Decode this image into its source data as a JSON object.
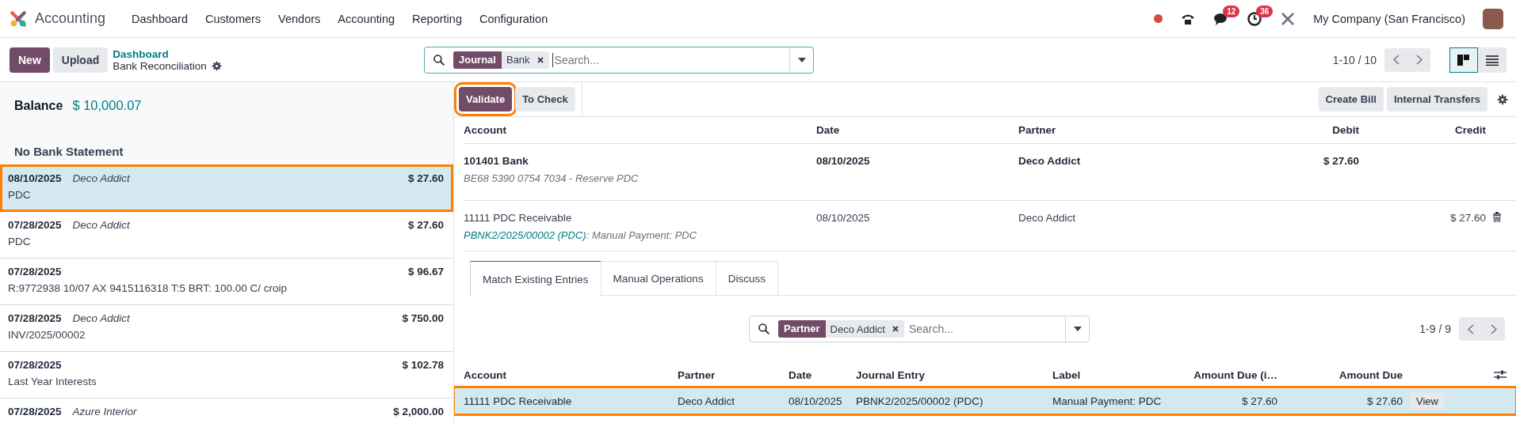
{
  "navbar": {
    "app": "Accounting",
    "menu": [
      "Dashboard",
      "Customers",
      "Vendors",
      "Accounting",
      "Reporting",
      "Configuration"
    ],
    "messages_count": "12",
    "activities_count": "36",
    "company": "My Company (San Francisco)"
  },
  "control_panel": {
    "buttons": [
      {
        "label": "New",
        "primary": true
      },
      {
        "label": "Upload",
        "primary": false
      }
    ],
    "breadcrumb": {
      "parent": "Dashboard",
      "current": "Bank Reconciliation"
    },
    "search": {
      "facets": [
        {
          "label": "Journal",
          "value": "Bank"
        }
      ],
      "placeholder": "Search..."
    },
    "pager": "1-10 / 10",
    "views": [
      {
        "kind": "kanban",
        "selected": true
      },
      {
        "kind": "list",
        "selected": false
      }
    ]
  },
  "statement_panel": {
    "balance_label": "Balance",
    "balance": "$ 10,000.07",
    "group": "No Bank Statement",
    "lines": [
      {
        "date": "08/10/2025",
        "partner": "Deco Addict",
        "amount": "$ 27.60",
        "label": "PDC",
        "selected": true,
        "highlighted": true
      },
      {
        "date": "07/28/2025",
        "partner": "Deco Addict",
        "amount": "$ 27.60",
        "label": "PDC",
        "selected": false,
        "highlighted": false
      },
      {
        "date": "07/28/2025",
        "amount": "$ 96.67",
        "label": "R:9772938 10/07 AX 9415116318 T:5 BRT: 100.00 C/ croip",
        "selected": false,
        "highlighted": false
      },
      {
        "date": "07/28/2025",
        "partner": "Deco Addict",
        "amount": "$ 750.00",
        "label": "INV/2025/00002",
        "selected": false,
        "highlighted": false
      },
      {
        "date": "07/28/2025",
        "amount": "$ 102.78",
        "label": "Last Year Interests",
        "selected": false,
        "highlighted": false
      },
      {
        "date": "07/28/2025",
        "partner": "Azure Interior",
        "amount": "$ 2,000.00",
        "selected": false,
        "highlighted": false
      }
    ]
  },
  "entry_panel": {
    "actions": [
      {
        "label": "Validate",
        "primary": true,
        "highlighted": true
      },
      {
        "label": "To Check",
        "primary": false,
        "highlighted": false
      }
    ],
    "extra_actions": [
      "Create Bill",
      "Internal Transfers"
    ],
    "columns": [
      "Account",
      "Date",
      "Partner",
      "Debit",
      "Credit"
    ],
    "lines": [
      {
        "kind": "bank",
        "account": "101401 Bank",
        "detail": "BE68 5390 0754 7034 - Reserve PDC",
        "date": "08/10/2025",
        "partner": "Deco Addict",
        "debit": "$ 27.60"
      },
      {
        "kind": "counterpart",
        "account": "11111 PDC Receivable",
        "link": "PBNK2/2025/00002 (PDC)",
        "detail": ": Manual Payment: PDC",
        "date": "08/10/2025",
        "partner": "Deco Addict",
        "credit": "$ 27.60"
      }
    ]
  },
  "tabs": [
    {
      "label": "Match Existing Entries",
      "selected": true
    },
    {
      "label": "Manual Operations",
      "selected": false
    },
    {
      "label": "Discuss",
      "selected": false
    }
  ],
  "match": {
    "search": {
      "facets": [
        {
          "label": "Partner",
          "value": "Deco Addict"
        }
      ],
      "placeholder": "Search..."
    },
    "pager": "1-9 / 9",
    "columns": [
      "Account",
      "Partner",
      "Date",
      "Journal Entry",
      "Label",
      "Amount Due (i…",
      "Amount Due"
    ],
    "rows": [
      {
        "cells": [
          "11111 PDC Receivable",
          "Deco Addict",
          "08/10/2025",
          "PBNK2/2025/00002 (PDC)",
          "Manual Payment: PDC",
          "$ 27.60",
          "$ 27.60"
        ],
        "action": "View",
        "selected": true,
        "highlighted": true
      }
    ]
  }
}
